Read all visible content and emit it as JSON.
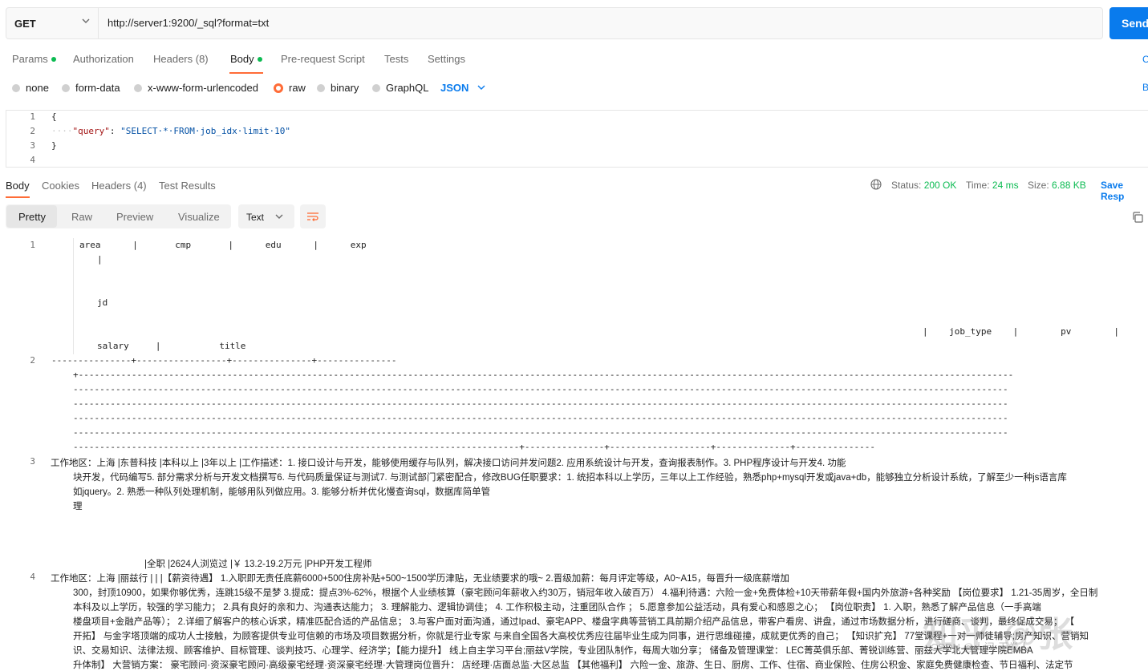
{
  "request": {
    "method": "GET",
    "url": "http://server1:9200/_sql?format=txt",
    "send_label": "Send"
  },
  "request_tabs": {
    "params": "Params",
    "authorization": "Authorization",
    "headers": "Headers (8)",
    "body": "Body",
    "prerequest": "Pre-request Script",
    "tests": "Tests",
    "settings": "Settings",
    "right_edge": "C"
  },
  "body_types": {
    "none": "none",
    "form_data": "form-data",
    "urlencoded": "x-www-form-urlencoded",
    "raw": "raw",
    "binary": "binary",
    "graphql": "GraphQL",
    "format": "JSON",
    "right_edge": "B"
  },
  "editor": {
    "line_numbers": [
      "1",
      "2",
      "3",
      "4"
    ],
    "l1": "{",
    "l2_indent": "····",
    "l2_key": "\"query\"",
    "l2_colon": ": ",
    "l2_value": "\"SELECT·*·FROM·job_idx·limit·10\"",
    "l3": "}"
  },
  "response_tabs": {
    "body": "Body",
    "cookies": "Cookies",
    "headers": "Headers (4)",
    "test_results": "Test Results"
  },
  "response_status": {
    "status_label": "Status:",
    "status_value": "200 OK",
    "time_label": "Time:",
    "time_value": "24 ms",
    "size_label": "Size:",
    "size_value": "6.88 KB",
    "save_label": "Save Resp"
  },
  "view_modes": {
    "pretty": "Pretty",
    "raw": "Raw",
    "preview": "Preview",
    "visualize": "Visualize",
    "text_format": "Text"
  },
  "response_body": {
    "line_numbers": [
      "1",
      "2",
      "3",
      "4"
    ],
    "header_row": "area      |       cmp       |      edu      |      exp",
    "pipe": "|",
    "jd": "jd",
    "right_cols": "|    job_type    |        pv        |",
    "salary_title": "salary     |           title",
    "sep1": "---------------+-----------------+---------------+---------------",
    "sep_lines": [
      "+--------------------------------------------------------------------------------------------------------------------------------------------------------------------------------",
      "--------------------------------------------------------------------------------------------------------------------------------------------------------------------------------",
      "--------------------------------------------------------------------------------------------------------------------------------------------------------------------------------",
      "--------------------------------------------------------------------------------------------------------------------------------------------------------------------------------",
      "--------------------------------------------------------------------------------------------------------------------------------------------------------------------------------"
    ],
    "sep_last": "------------------------------------------------------------------------------------+---------------+-------------------+--------------+---------------",
    "row3_head": "工作地区：上海        |东普科技              |本科以上             |3年以上             |工作描述：1. 接口设计与开发，能够使用缓存与队列，解决接口访问并发问题2. 应用系统设计与开发，查询报表制作。3. PHP程序设计与开发4. 功能",
    "row3_l2": "块开发，代码编写5. 部分需求分析与开发文档撰写6. 与代码质量保证与测试7. 与测试部门紧密配合，修改BUG任职要求：1. 统招本科以上学历，三年以上工作经验，熟悉php+mysql开发或java+db，能够独立分析设计系统，了解至少一种js语言库",
    "row3_l3": "如jquery。2. 熟悉一种队列处理机制，能够用队列做应用。3. 能够分析并优化慢查询sql，数据库简单管",
    "row3_l4": "理",
    "row3_tail": "|全职              |2624人浏览过              |￥ 13.2-19.2万元    |PHP开发工程师",
    "row4_head": "工作地区：上海        |丽兹行               |                  |                 |【薪资待遇】 1.入职即无责任底薪6000+500住房补贴+500~1500学历津贴，无业绩要求的哦~ 2.晋级加薪：每月评定等级，A0~A15，每晋升一级底薪增加",
    "row4_l2": "300，封顶10900，如果你够优秀，连跳15级不是梦 3.提成：提点3%-62%，根据个人业绩核算（豪宅顾问年薪收入约30万，销冠年收入破百万） 4.福利待遇：六险一金+免费体检+10天带薪年假+国内外旅游+各种奖励 【岗位要求】 1.21-35周岁，全日制",
    "row4_l3": "本科及以上学历，较强的学习能力； 2.具有良好的亲和力、沟通表达能力； 3. 理解能力、逻辑协调佳； 4. 工作积极主动，注重团队合作 ； 5.愿意参加公益活动，具有爱心和感恩之心； 【岗位职责】 1. 入职，熟悉了解产品信息（一手高端",
    "row4_l4": "楼盘项目+金融产品等）； 2.详细了解客户的核心诉求，精准匹配合适的产品信息； 3.与客户面对面沟通，通过Ipad、豪宅APP、楼盘字典等营销工具前期介绍产品信息，带客户看房、讲盘，通过市场数据分析，进行磋商、谈判，最终促成交易； 【",
    "row4_l5": "开拓】 与金字塔顶端的成功人士接触，为顾客提供专业可信赖的市场及项目数据分析，你就是行业专家 与来自全国各大高校优秀应往届毕业生成为同事，进行思维碰撞，成就更优秀的自己； 【知识扩充】 77堂课程+一对一师徒辅导;房产知识、营销知",
    "row4_l6": "识、交易知识、法律法规、顾客维护、目标管理、谈判技巧、心理学、经济学；【能力提升】 线上自主学习平台;丽兹V学院，专业团队制作，每周大咖分享； 储备及管理课堂： LEC菁英俱乐部、菁锐训练营、丽兹大学北大管理学院EMBA",
    "row4_l7": "升体制】 大营销方案：  豪宅顾问·资深豪宅顾问·高级豪宅经理·资深豪宅经理·大管理岗位晋升： 店经理·店面总监·大区总监 【其他福利】 六险一金、旅游、生日、厨房、工作、住宿、商业保险、住房公积金、家庭免费健康检查、节日福利、法定节"
  },
  "watermark": {
    "main": "知乎 @张",
    "sub": "CSDN @人间·无卷人"
  },
  "colors": {
    "accent": "#ff6c37",
    "primary": "#097bed",
    "success": "#0cbb52"
  }
}
